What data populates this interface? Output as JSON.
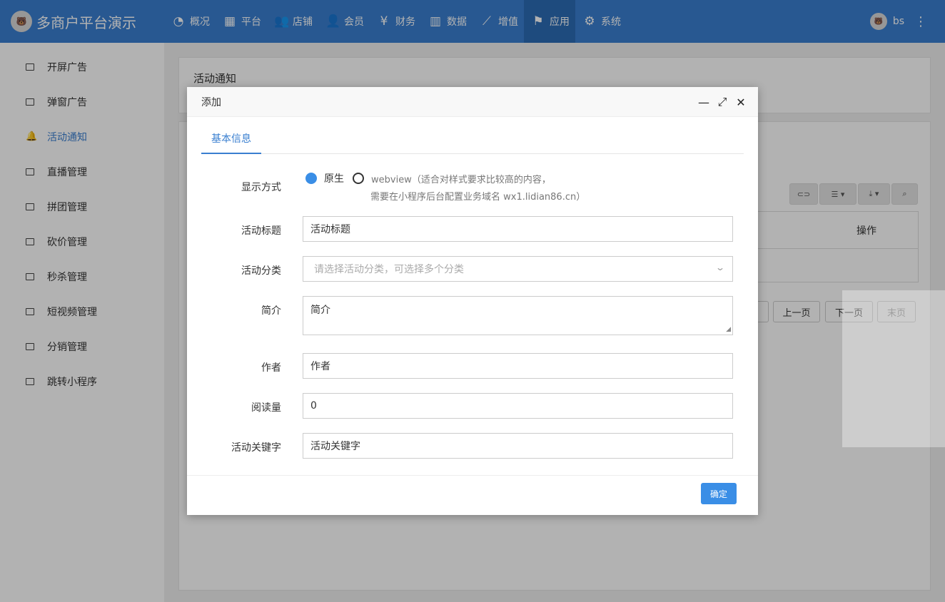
{
  "app": {
    "brand": "多商户平台演示",
    "user": "bs"
  },
  "topnav": [
    {
      "label": "概况",
      "icon": "dashboard-icon"
    },
    {
      "label": "平台",
      "icon": "grid-icon"
    },
    {
      "label": "店铺",
      "icon": "users-icon"
    },
    {
      "label": "会员",
      "icon": "user-plus-icon"
    },
    {
      "label": "财务",
      "icon": "yen-icon"
    },
    {
      "label": "数据",
      "icon": "bar-chart-icon"
    },
    {
      "label": "增值",
      "icon": "line-chart-icon"
    },
    {
      "label": "应用",
      "icon": "flag-icon",
      "active": true
    },
    {
      "label": "系统",
      "icon": "gear-icon"
    }
  ],
  "sidebar": {
    "items": [
      {
        "label": "开屏广告"
      },
      {
        "label": "弹窗广告"
      },
      {
        "label": "活动通知",
        "active": true
      },
      {
        "label": "直播管理"
      },
      {
        "label": "拼团管理"
      },
      {
        "label": "砍价管理"
      },
      {
        "label": "秒杀管理"
      },
      {
        "label": "短视频管理"
      },
      {
        "label": "分销管理"
      },
      {
        "label": "跳转小程序"
      }
    ]
  },
  "main": {
    "panel_title": "活动通知",
    "table_header_ops": "操作",
    "pagination": {
      "prev": "上一页",
      "next": "下一页",
      "last": "末页"
    }
  },
  "modal": {
    "title": "添加",
    "tab": "基本信息",
    "display_mode": {
      "label": "显示方式",
      "option_native": "原生",
      "option_webview": "webview（适合对样式要求比较高的内容，",
      "note": "需要在小程序后台配置业务域名 wx1.lidian86.cn）"
    },
    "fields": {
      "title": {
        "label": "活动标题",
        "value": "活动标题"
      },
      "category": {
        "label": "活动分类",
        "placeholder": "请选择活动分类，可选择多个分类"
      },
      "intro": {
        "label": "简介",
        "value": "简介"
      },
      "author": {
        "label": "作者",
        "value": "作者"
      },
      "reads": {
        "label": "阅读量",
        "value": "0"
      },
      "keywords": {
        "label": "活动关键字",
        "value": "活动关键字"
      }
    },
    "confirm": "确定"
  }
}
